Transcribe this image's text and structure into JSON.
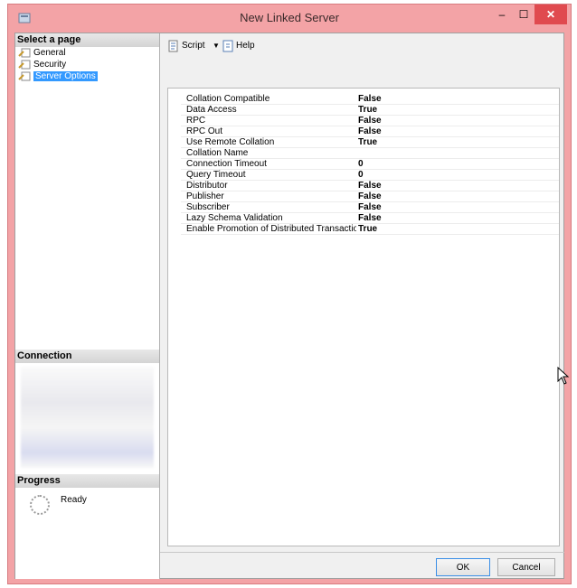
{
  "window": {
    "title": "New Linked Server",
    "controls": {
      "minimize": "–",
      "maximize": "☐",
      "close": "✕"
    }
  },
  "sidebar": {
    "select_page_title": "Select a page",
    "pages": [
      {
        "label": "General",
        "icon": "wrench-page-icon",
        "selected": false
      },
      {
        "label": "Security",
        "icon": "wrench-page-icon",
        "selected": false
      },
      {
        "label": "Server Options",
        "icon": "wrench-page-icon",
        "selected": true
      }
    ],
    "connection_title": "Connection",
    "progress_title": "Progress",
    "progress_status": "Ready"
  },
  "toolbar": {
    "script_label": "Script",
    "dropdown_glyph": "▼",
    "help_label": "Help"
  },
  "options": [
    {
      "name": "Collation Compatible",
      "value": "False"
    },
    {
      "name": "Data Access",
      "value": "True"
    },
    {
      "name": "RPC",
      "value": "False"
    },
    {
      "name": "RPC Out",
      "value": "False"
    },
    {
      "name": "Use Remote Collation",
      "value": "True"
    },
    {
      "name": "Collation Name",
      "value": ""
    },
    {
      "name": "Connection Timeout",
      "value": "0"
    },
    {
      "name": "Query Timeout",
      "value": "0"
    },
    {
      "name": "Distributor",
      "value": "False"
    },
    {
      "name": "Publisher",
      "value": "False"
    },
    {
      "name": "Subscriber",
      "value": "False"
    },
    {
      "name": "Lazy Schema Validation",
      "value": "False"
    },
    {
      "name": "Enable Promotion of Distributed Transaction",
      "value": "True"
    }
  ],
  "footer": {
    "ok_label": "OK",
    "cancel_label": "Cancel"
  },
  "colors": {
    "accent_frame": "#f3a3a6",
    "close_button": "#e04a4f",
    "selection": "#3399ff"
  }
}
